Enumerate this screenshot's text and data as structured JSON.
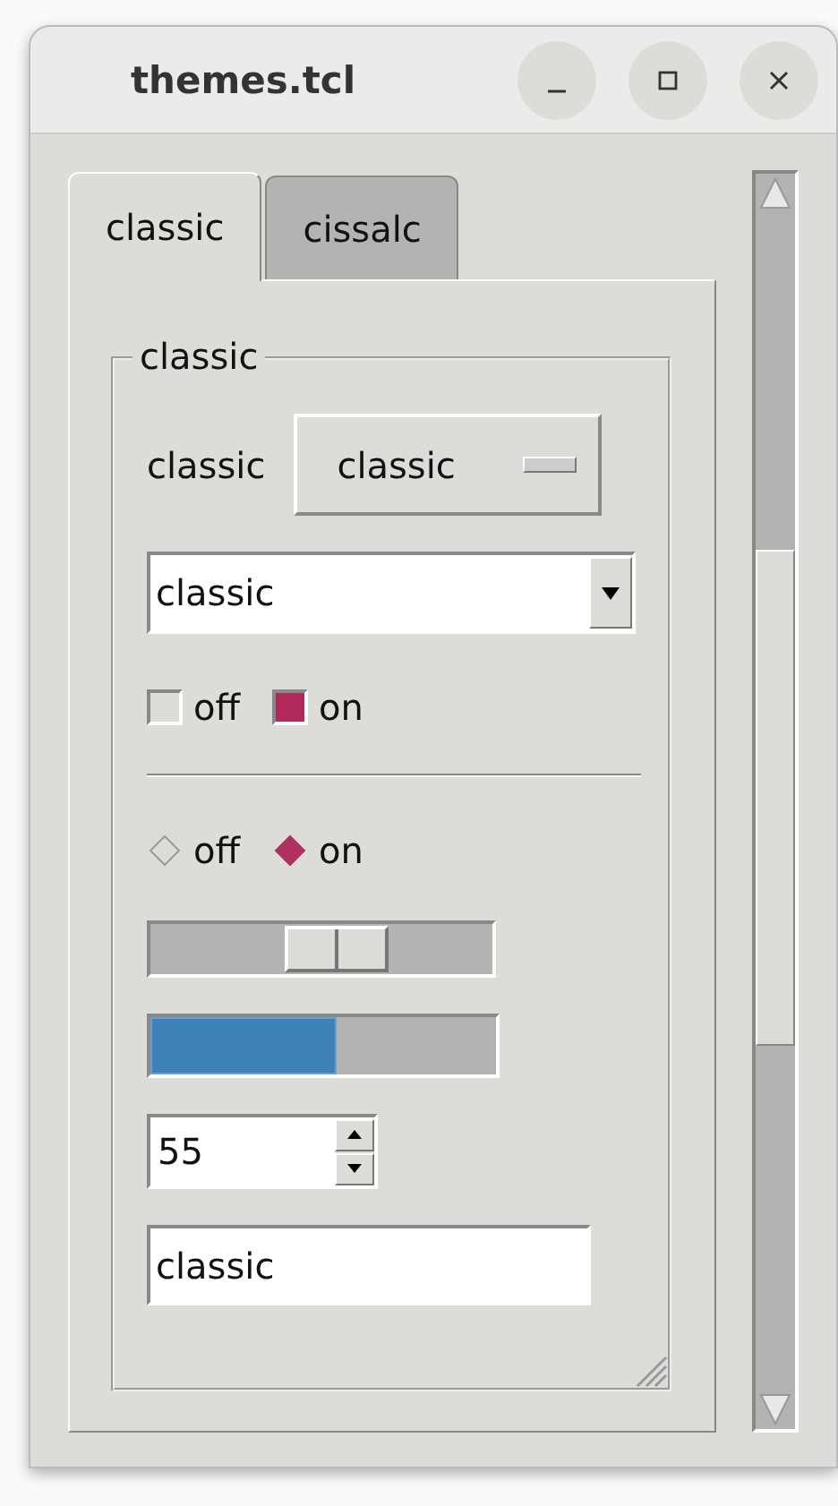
{
  "window": {
    "title": "themes.tcl"
  },
  "tabs": [
    {
      "label": "classic",
      "selected": true
    },
    {
      "label": "cissalc",
      "selected": false
    }
  ],
  "group": {
    "title": "classic",
    "label": "classic",
    "menubutton": "classic",
    "combobox": "classic",
    "checks": [
      {
        "label": "off",
        "checked": false
      },
      {
        "label": "on",
        "checked": true
      }
    ],
    "radios": [
      {
        "label": "off",
        "selected": false
      },
      {
        "label": "on",
        "selected": true
      }
    ],
    "scale": {
      "level": 0.55
    },
    "progress": {
      "level": 0.54
    },
    "spinbox": {
      "value": "55"
    },
    "entry": {
      "value": "classic"
    }
  }
}
